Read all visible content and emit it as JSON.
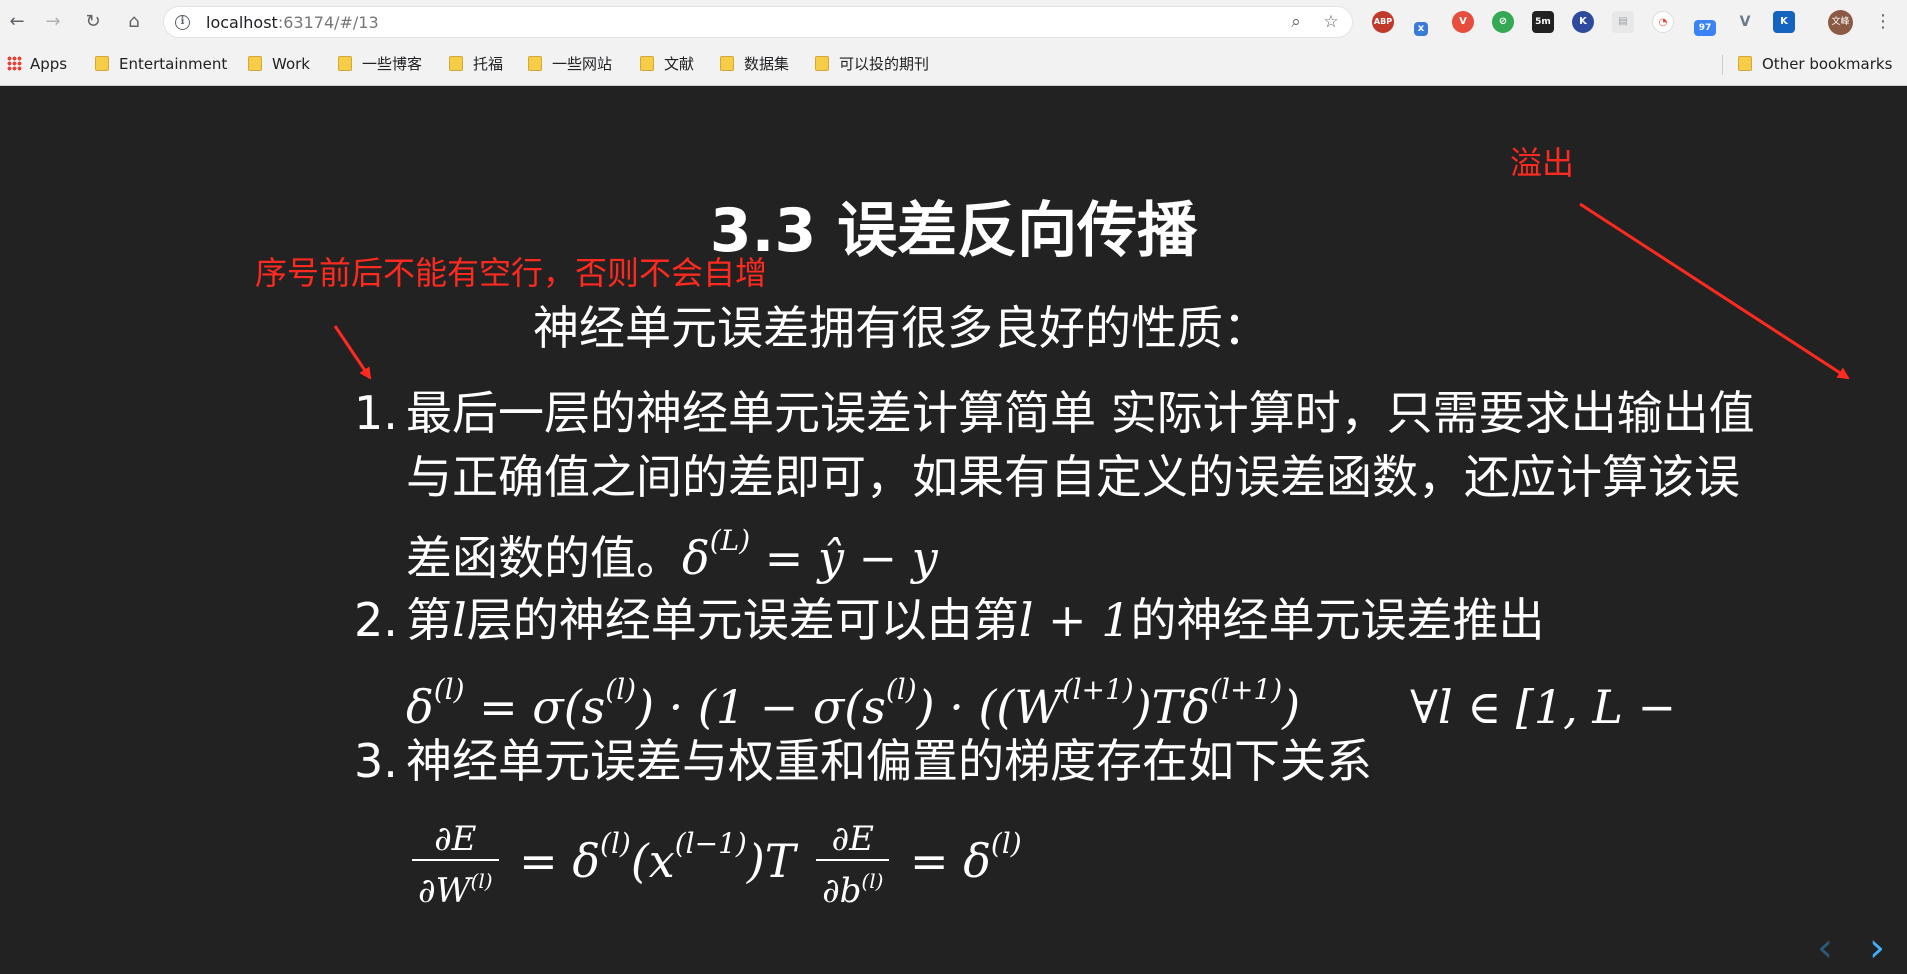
{
  "browser": {
    "url_host": "localhost",
    "url_rest": ":63174/#/13",
    "avatar_label": "文峰",
    "extensions": [
      {
        "name": "adblock-icon",
        "label": "ABP",
        "color": "#c0392b"
      },
      {
        "name": "extension-x-icon",
        "label": "x",
        "color": "#3a7bd5"
      },
      {
        "name": "vivaldi-icon",
        "label": "V",
        "color": "#e74c3c"
      },
      {
        "name": "compass-icon",
        "label": "⊘",
        "color": "#34a853"
      },
      {
        "name": "timer-icon",
        "label": "5m",
        "color": "#222222"
      },
      {
        "name": "k-circle-icon",
        "label": "K",
        "color": "#2e4a9e"
      },
      {
        "name": "document-icon",
        "label": "▤",
        "color": "#9aa0a6"
      },
      {
        "name": "clock-icon",
        "label": "◔",
        "color": "#e74c3c"
      },
      {
        "name": "rss-icon",
        "label": "97",
        "color": "#f39c12"
      },
      {
        "name": "vue-devtools-icon",
        "label": "V",
        "color": "#6b7a88"
      },
      {
        "name": "k-square-icon",
        "label": "K",
        "color": "#1565c0"
      }
    ]
  },
  "bookmarks": {
    "apps": "Apps",
    "items": [
      "Entertainment",
      "Work",
      "一些博客",
      "托福",
      "一些网站",
      "文献",
      "数据集",
      "可以投的期刊"
    ],
    "other": "Other bookmarks"
  },
  "slide": {
    "title": "3.3 误差反向传播",
    "intro": "神经单元误差拥有很多良好的性质：",
    "items": [
      {
        "num": "1.",
        "line1": "最后一层的神经单元误差计算简单 实际计算时，只需要求出输出值",
        "line2": "与正确值之间的差即可，如果有自定义的误差函数，还应计算该误",
        "line3_text": "差函数的值。",
        "line3_math_delta": "δ",
        "line3_math_sup": "(L)",
        "line3_math_rest": " = ŷ − y"
      },
      {
        "num": "2.",
        "line1_a": "第",
        "line1_l": "l",
        "line1_b": "层的神经单元误差可以由第",
        "line1_l1": "l + 1",
        "line1_c": "的神经单元误差推出",
        "formula_delta": "δ",
        "formula_sup1": "(l)",
        "formula_mid1": " = σ(s",
        "formula_sup2": "(l)",
        "formula_mid2": ") · (1 − σ(s",
        "formula_sup3": "(l)",
        "formula_mid3": ") · ((W",
        "formula_sup4": "(l+1)",
        "formula_mid4": ")Tδ",
        "formula_sup5": "(l+1)",
        "formula_mid5": ")",
        "formula_forall": "∀l ∈ [1, L −"
      },
      {
        "num": "3.",
        "line1": "神经单元误差与权重和偏置的梯度存在如下关系",
        "frac1_num": "∂E",
        "frac1_den": "∂W",
        "frac1_den_sup": "(l)",
        "eq1_a": " = δ",
        "eq1_sup1": "(l)",
        "eq1_b": "(x",
        "eq1_sup2": "(l−1)",
        "eq1_c": ")T ",
        "frac2_num": "∂E",
        "frac2_den": "∂b",
        "frac2_den_sup": "(l)",
        "eq2_a": " = δ",
        "eq2_sup": "(l)"
      }
    ]
  },
  "annotations": {
    "overflow": "溢出",
    "numbering": "序号前后不能有空行，否则不会自增"
  },
  "colors": {
    "annotation": "#ff2a1f",
    "slide_bg": "#222222",
    "nav_active": "#42affa"
  }
}
